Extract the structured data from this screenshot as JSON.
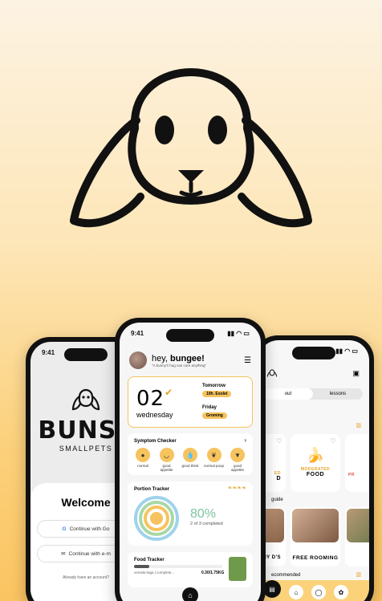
{
  "colors": {
    "accent": "#f6c35e",
    "progress_green": "#7cc4a0",
    "dark": "#111111"
  },
  "left_phone": {
    "time": "9:41",
    "brand": "BUNSS",
    "brand_sub": "SMALLPETS",
    "welcome": "Welcome",
    "google_btn": "Continue with Go",
    "email_btn": "Continue with e-m",
    "account_note": "Already have an account?"
  },
  "center_phone": {
    "time": "9:41",
    "greeting_prefix": "hey, ",
    "greeting_name": "bungee!",
    "quote": "\"A bunny's hug can cure anything\"",
    "date_number": "02",
    "date_day": "wednesday",
    "tomorrow_label": "Tomorrow",
    "tomorrow_event": "10h. Exolet",
    "friday_label": "Friday",
    "friday_event": "Groming",
    "symptom_title": "Symptom Checker",
    "symptoms": [
      {
        "label": "normal",
        "icon": "poop-icon"
      },
      {
        "label": "good appetite",
        "icon": "bowl-icon"
      },
      {
        "label": "good thirst",
        "icon": "drop-icon"
      },
      {
        "label": "normal poop",
        "icon": "leaf-icon"
      },
      {
        "label": "good appetite",
        "icon": "carrot-icon"
      }
    ],
    "portion_title": "Portion Tracker",
    "portion_percent": "80%",
    "portion_sub": "2 of 3 completed",
    "portion_progress": 0.8,
    "food_title": "Food Tracker",
    "food_sub": "versele-laga | complete...",
    "food_value": "0.30/1.75KG",
    "food_progress": 0.17
  },
  "right_phone": {
    "tab_about": "out",
    "tab_lessons": "lessons",
    "food_cards": [
      {
        "tag": "ED",
        "label": "D"
      },
      {
        "tag": "MODERATED",
        "label": "FOOD"
      },
      {
        "tag": "PR",
        "label": ""
      }
    ],
    "guide_label": "guide",
    "guide_cards": [
      {
        "label": "NY D'S"
      },
      {
        "label": "FREE ROOMING"
      }
    ],
    "recommended_label": "ecommended"
  }
}
